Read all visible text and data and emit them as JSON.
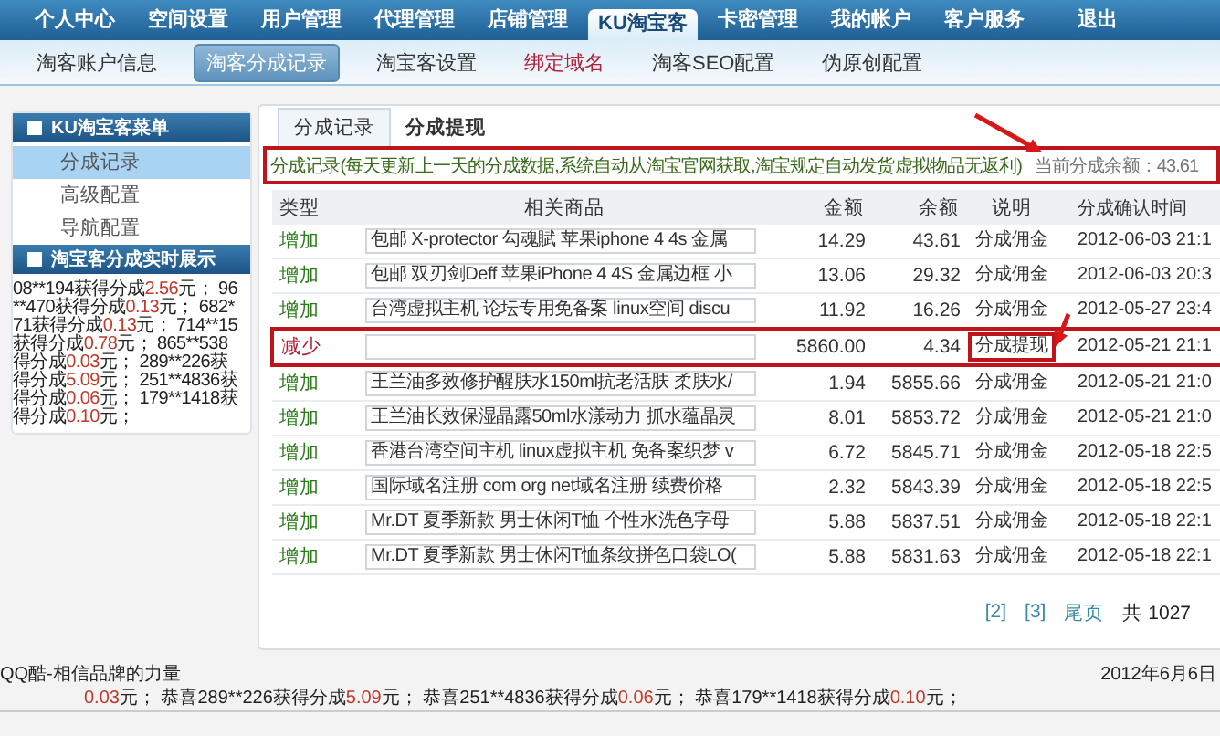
{
  "top_nav": [
    {
      "label": "个人中心",
      "selected": false
    },
    {
      "label": "空间设置",
      "selected": false
    },
    {
      "label": "用户管理",
      "selected": false
    },
    {
      "label": "代理管理",
      "selected": false
    },
    {
      "label": "店铺管理",
      "selected": false
    },
    {
      "label": "KU淘宝客",
      "selected": true
    },
    {
      "label": "卡密管理",
      "selected": false
    },
    {
      "label": "我的帐户",
      "selected": false
    },
    {
      "label": "客户服务",
      "selected": false
    },
    {
      "label": "退出",
      "selected": false
    }
  ],
  "sub_nav": [
    {
      "label": "淘客账户信息",
      "selected": false,
      "highlight": false
    },
    {
      "label": "淘客分成记录",
      "selected": true,
      "highlight": false
    },
    {
      "label": "淘宝客设置",
      "selected": false,
      "highlight": false
    },
    {
      "label": "绑定域名",
      "selected": false,
      "highlight": true
    },
    {
      "label": "淘客SEO配置",
      "selected": false,
      "highlight": false
    },
    {
      "label": "伪原创配置",
      "selected": false,
      "highlight": false
    }
  ],
  "sidebar": {
    "menu_title": "KU淘宝客菜单",
    "items": [
      {
        "label": "分成记录",
        "selected": true
      },
      {
        "label": "高级配置",
        "selected": false
      },
      {
        "label": "导航配置",
        "selected": false
      }
    ],
    "ticker_title": "淘宝客分成实时展示",
    "ticker_lines": [
      [
        {
          "text": "08**194获得分成",
          "amount": false
        },
        {
          "text": "2.56",
          "amount": true
        },
        {
          "text": "元； 96",
          "amount": false
        }
      ],
      [
        {
          "text": "**470获得分成",
          "amount": false
        },
        {
          "text": "0.13",
          "amount": true
        },
        {
          "text": "元； 682*",
          "amount": false
        }
      ],
      [
        {
          "text": "71获得分成",
          "amount": false
        },
        {
          "text": "0.13",
          "amount": true
        },
        {
          "text": "元； 714**15",
          "amount": false
        }
      ],
      [
        {
          "text": "获得分成",
          "amount": false
        },
        {
          "text": "0.78",
          "amount": true
        },
        {
          "text": "元； 865**538",
          "amount": false
        }
      ],
      [
        {
          "text": "得分成",
          "amount": false
        },
        {
          "text": "0.03",
          "amount": true
        },
        {
          "text": "元； 289**226获",
          "amount": false
        }
      ],
      [
        {
          "text": "得分成",
          "amount": false
        },
        {
          "text": "5.09",
          "amount": true
        },
        {
          "text": "元； 251**4836获",
          "amount": false
        }
      ],
      [
        {
          "text": "得分成",
          "amount": false
        },
        {
          "text": "0.06",
          "amount": true
        },
        {
          "text": "元； 179**1418获",
          "amount": false
        }
      ],
      [
        {
          "text": "得分成",
          "amount": false
        },
        {
          "text": "0.10",
          "amount": true
        },
        {
          "text": "元；",
          "amount": false
        }
      ]
    ]
  },
  "main": {
    "tabs": [
      {
        "label": "分成记录",
        "selected": true
      },
      {
        "label": "分成提现",
        "selected": false
      }
    ],
    "notice": {
      "text": "分成记录(每天更新上一天的分成数据,系统自动从淘宝官网获取,淘宝规定自动发货虚拟物品无返利)",
      "balance": "当前分成余额：43.61",
      "highlighted": true
    },
    "table": {
      "columns": [
        "类型",
        "相关商品",
        "金额",
        "余额",
        "说明",
        "分成确认时间"
      ],
      "rows": [
        {
          "type": "增加",
          "kind": "increase",
          "product": "包邮 X-protector 勾魂賦 苹果iphone 4 4s 金属",
          "amount": "14.29",
          "balance": "43.61",
          "note": "分成佣金",
          "date": "2012-06-03 21:1",
          "highlighted": false,
          "note_highlighted": false
        },
        {
          "type": "增加",
          "kind": "increase",
          "product": "包邮 双刃剑Deff 苹果iPhone 4 4S 金属边框 小",
          "amount": "13.06",
          "balance": "29.32",
          "note": "分成佣金",
          "date": "2012-06-03 20:3",
          "highlighted": false,
          "note_highlighted": false
        },
        {
          "type": "增加",
          "kind": "increase",
          "product": "台湾虚拟主机 论坛专用免备案 linux空间 discu",
          "amount": "11.92",
          "balance": "16.26",
          "note": "分成佣金",
          "date": "2012-05-27 23:4",
          "highlighted": false,
          "note_highlighted": false
        },
        {
          "type": "减少",
          "kind": "decrease",
          "product": "",
          "amount": "5860.00",
          "balance": "4.34",
          "note": "分成提现",
          "date": "2012-05-21 21:1",
          "highlighted": true,
          "note_highlighted": true
        },
        {
          "type": "增加",
          "kind": "increase",
          "product": "王兰油多效修护醒肤水150ml抗老活肤 柔肤水/",
          "amount": "1.94",
          "balance": "5855.66",
          "note": "分成佣金",
          "date": "2012-05-21 21:0",
          "highlighted": false,
          "note_highlighted": false
        },
        {
          "type": "增加",
          "kind": "increase",
          "product": "王兰油长效保湿晶露50ml水漾动力 抓水蕴晶灵",
          "amount": "8.01",
          "balance": "5853.72",
          "note": "分成佣金",
          "date": "2012-05-21 21:0",
          "highlighted": false,
          "note_highlighted": false
        },
        {
          "type": "增加",
          "kind": "increase",
          "product": "香港台湾空间主机 linux虚拟主机 免备案织梦 v",
          "amount": "6.72",
          "balance": "5845.71",
          "note": "分成佣金",
          "date": "2012-05-18 22:5",
          "highlighted": false,
          "note_highlighted": false
        },
        {
          "type": "增加",
          "kind": "increase",
          "product": "国际域名注册 com org net域名注册 续费价格",
          "amount": "2.32",
          "balance": "5843.39",
          "note": "分成佣金",
          "date": "2012-05-18 22:5",
          "highlighted": false,
          "note_highlighted": false
        },
        {
          "type": "增加",
          "kind": "increase",
          "product": "Mr.DT 夏季新款 男士休闲T恤 个性水洗色字母",
          "amount": "5.88",
          "balance": "5837.51",
          "note": "分成佣金",
          "date": "2012-05-18 22:1",
          "highlighted": false,
          "note_highlighted": false
        },
        {
          "type": "增加",
          "kind": "increase",
          "product": "Mr.DT 夏季新款 男士休闲T恤条纹拼色口袋LO(",
          "amount": "5.88",
          "balance": "5831.63",
          "note": "分成佣金",
          "date": "2012-05-18 22:1",
          "highlighted": false,
          "note_highlighted": false
        }
      ]
    },
    "pagination": [
      "[2]",
      "[3]",
      "尾页"
    ],
    "page_total": "共 1027"
  },
  "footer": {
    "brand": "QQ酷-相信品牌的力量",
    "date": "2012年6月6日",
    "ticker": [
      {
        "text": "0.03",
        "amount": true
      },
      {
        "text": "元； 恭喜289**226获得分成",
        "amount": false
      },
      {
        "text": "5.09",
        "amount": true
      },
      {
        "text": "元； 恭喜251**4836获得分成",
        "amount": false
      },
      {
        "text": "0.06",
        "amount": true
      },
      {
        "text": "元； 恭喜179**1418获得分成",
        "amount": false
      },
      {
        "text": "0.10",
        "amount": true
      },
      {
        "text": "元；",
        "amount": false
      }
    ]
  }
}
